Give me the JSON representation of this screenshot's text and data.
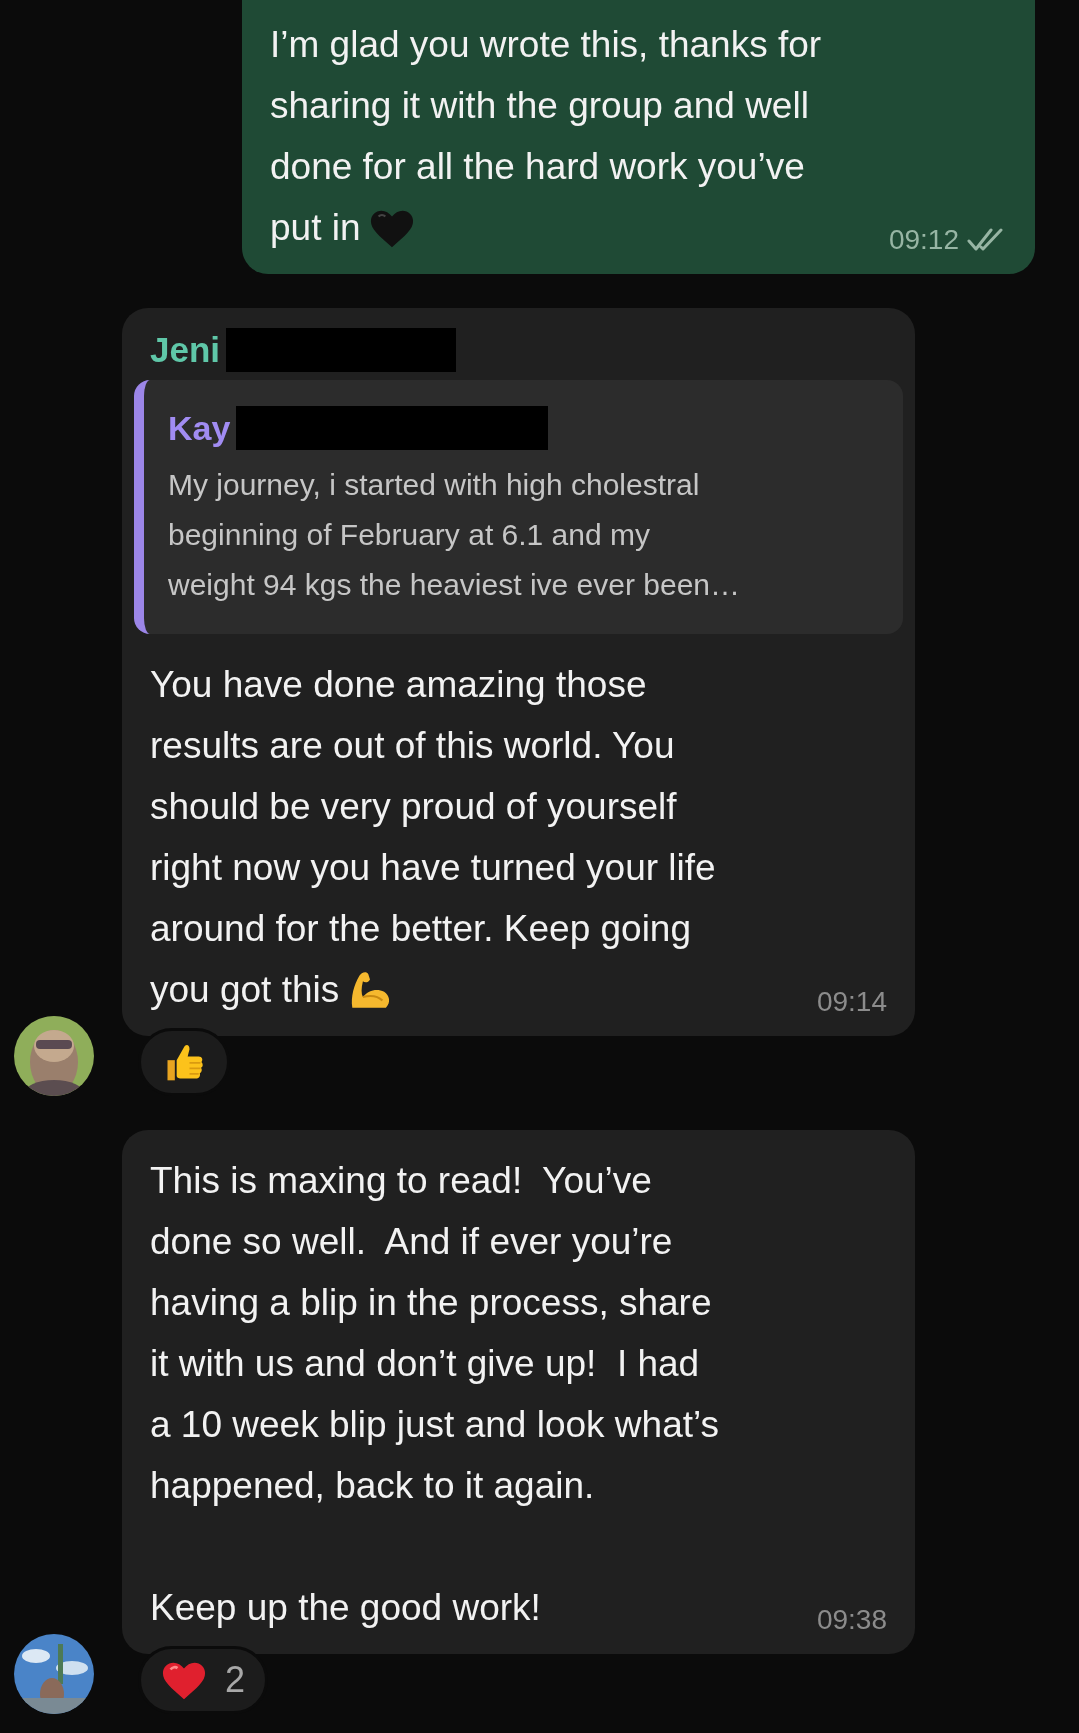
{
  "messages": [
    {
      "kind": "outgoing",
      "text": "I’m glad you wrote this, thanks for\nsharing it with the group and well\ndone for all the hard work you’ve",
      "end_line": {
        "text": "put in",
        "icon": {
          "kind": "heart"
        }
      },
      "time": "09:12"
    },
    {
      "kind": "incoming",
      "sender": "Jeni",
      "sender_redacted": true,
      "quote": {
        "sender": "Kay",
        "sender_redacted": true,
        "text": "My journey, i started with high cholestral\nbeginning of February at 6.1 and my\nweight 94 kgs the heaviest ive ever been…"
      },
      "text": "You have done amazing those\nresults are out of this world. You\nshould be very proud of yourself\nright now you have turned your life\naround for the better. Keep going",
      "end_line": {
        "text": "you got this",
        "icon": {
          "kind": "arm"
        }
      },
      "time": "09:14",
      "reaction": {
        "kind": "thumbs-up"
      }
    },
    {
      "kind": "incoming",
      "text": "This is maxing to read!  You’ve\ndone so well.  And if ever you’re\nhaving a blip in the process, share\nit with us and don’t give up!  I had\na 10 week blip just and look what’s\nhappened, back to it again.\n\nKeep up the good work!",
      "time": "09:38",
      "reaction": {
        "kind": "heart",
        "count": "2"
      }
    }
  ]
}
